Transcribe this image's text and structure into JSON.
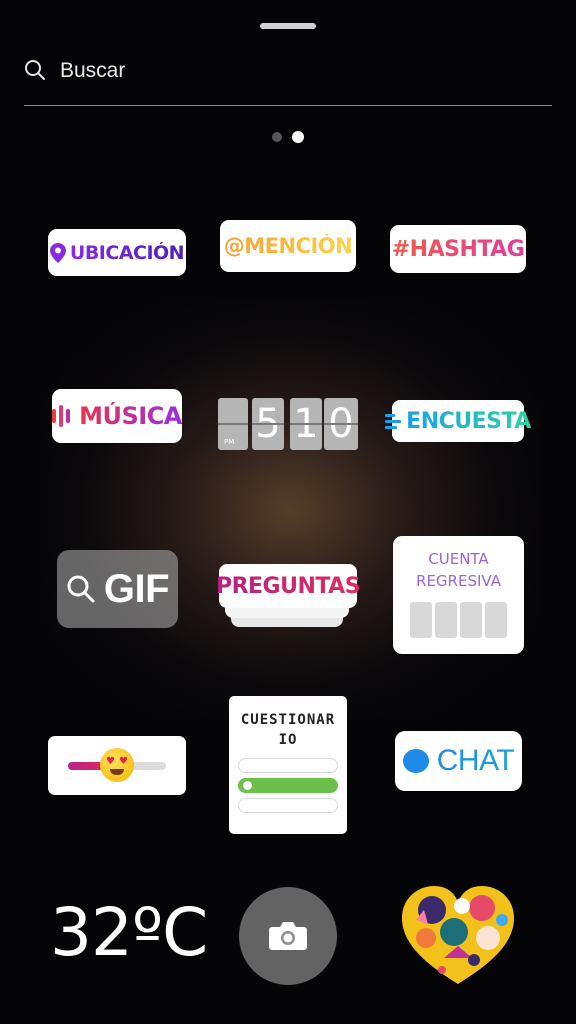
{
  "search": {
    "placeholder": "Buscar",
    "icon": "search-icon"
  },
  "pager": {
    "pages": 2,
    "active_index": 1
  },
  "stickers": {
    "ubicacion": "UBICACIÓN",
    "mencion": "@MENCIÓN",
    "hashtag": "#HASHTAG",
    "musica": "MÚSICA",
    "clock": {
      "pm": "PM",
      "d1": "5",
      "d2": "1",
      "d3": "0"
    },
    "encuesta": "ENCUESTA",
    "gif": "GIF",
    "preguntas": "PREGUNTAS",
    "cuenta_line1": "CUENTA",
    "cuenta_line2": "REGRESIVA",
    "cuestionario": "CUESTIONARIO",
    "chat": "CHAT",
    "temperature": "32ºC"
  },
  "colors": {
    "background": "#050507",
    "quiz_correct": "#6ac04b",
    "chat_blue": "#1e8be8"
  }
}
